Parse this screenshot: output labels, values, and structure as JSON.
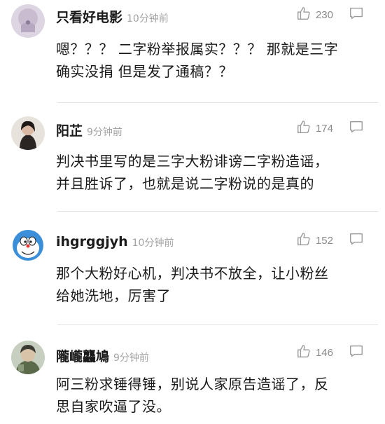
{
  "comments": [
    {
      "username": "只看好电影",
      "timestamp": "10分钟前",
      "likes": "230",
      "lines": [
        "嗯？？？ 二字粉举报属实？？？ 那就是三字",
        "确实没捐 但是发了通稿？？"
      ],
      "avatar_color": "#c9bcd0"
    },
    {
      "username": "阳芷",
      "timestamp": "9分钟前",
      "likes": "174",
      "lines": [
        "判决书里写的是三字大粉诽谤二字粉造谣，",
        "并且胜诉了，也就是说二字粉说的是真的"
      ],
      "avatar_color": "#5a4a44"
    },
    {
      "username": "ihgrggjyh",
      "timestamp": "10分钟前",
      "likes": "152",
      "lines": [
        "那个大粉好心机，判决书不放全，让小粉丝",
        "给她洗地，厉害了"
      ],
      "avatar_color": "#3b8fd9"
    },
    {
      "username": "隴巄龘鳩",
      "timestamp": "9分钟前",
      "likes": "146",
      "lines": [
        "阿三粉求锤得锤，别说人家原告造谣了，反",
        "思自家吹逼了没。"
      ],
      "avatar_color": "#7a8a6a"
    }
  ],
  "icons": {
    "like": "thumbs-up-icon",
    "reply": "comment-bubble-icon"
  },
  "colors": {
    "text": "#1a1a1a",
    "meta": "#a3a3a3",
    "icon": "#9a9a9a",
    "divider": "#e3e3e3"
  }
}
